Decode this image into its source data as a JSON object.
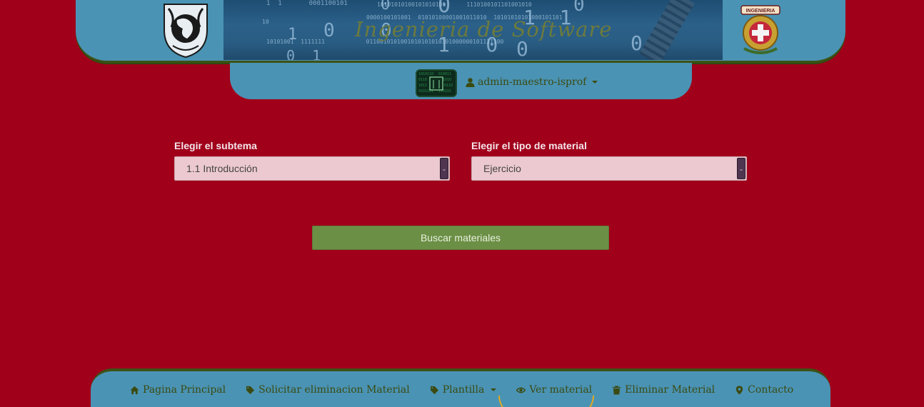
{
  "header": {
    "banner_title": "Ingenieria de Software"
  },
  "user": {
    "name": "admin-maestro-isprof"
  },
  "form": {
    "subtema_label": "Elegir el subtema",
    "subtema_value": "1.1 Introducción",
    "tipo_label": "Elegir el tipo de material",
    "tipo_value": "Ejercicio",
    "search_button": "Buscar materiales"
  },
  "nav": {
    "items": [
      {
        "label": "Pagina Principal",
        "icon": "home-icon"
      },
      {
        "label": "Solicitar eliminacion Material",
        "icon": "tag-icon"
      },
      {
        "label": "Plantilla",
        "icon": "tag-icon"
      },
      {
        "label": "Ver material",
        "icon": "eye-icon"
      },
      {
        "label": "Eliminar Material",
        "icon": "trash-icon"
      },
      {
        "label": "Contacto",
        "icon": "map-marker-icon"
      }
    ],
    "active": "Ver material"
  },
  "colors": {
    "background": "#a1001a",
    "panel": "#4a93b4",
    "button": "#6b8f45",
    "select_bg": "#ecc9d0"
  }
}
